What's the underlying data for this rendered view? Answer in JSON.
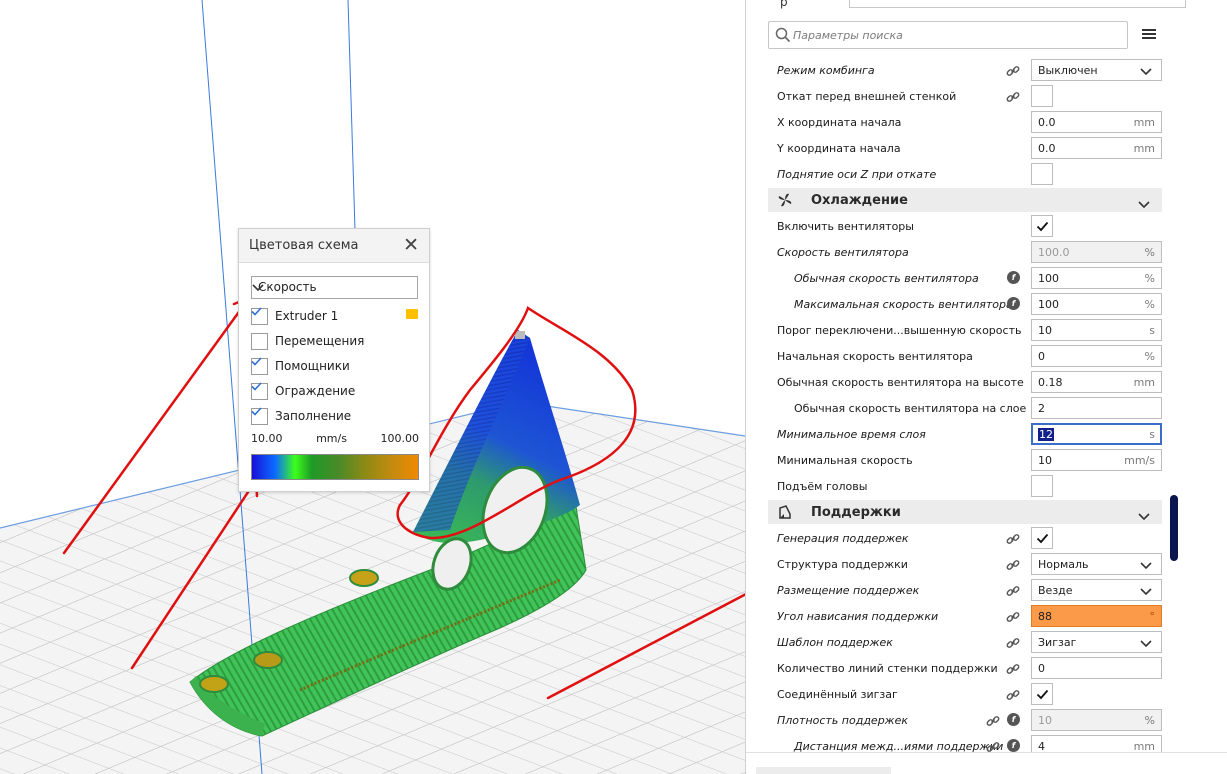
{
  "color_scheme": {
    "title": "Цветовая схема",
    "selected_scheme": "Скорость",
    "options": [
      {
        "label": "Extruder 1",
        "checked": true
      },
      {
        "label": "Перемещения",
        "checked": false
      },
      {
        "label": "Помощники",
        "checked": true
      },
      {
        "label": "Ограждение",
        "checked": true
      },
      {
        "label": "Заполнение",
        "checked": true
      }
    ],
    "legend_min": "10.00",
    "legend_unit": "mm/s",
    "legend_max": "100.00",
    "extruder_color": "#ffc000"
  },
  "settings": {
    "profile_label": "р",
    "search_placeholder": "Параметры поиска",
    "rows": [
      {
        "label": "Режим комбинга",
        "italic": true,
        "link": true,
        "type": "select",
        "value": "Выключен"
      },
      {
        "label": "Откат перед внешней стенкой",
        "italic": false,
        "link": true,
        "type": "checkbox",
        "checked": false
      },
      {
        "label": "X координата начала",
        "italic": false,
        "type": "input",
        "value": "0.0",
        "unit": "mm"
      },
      {
        "label": "Y координата начала",
        "italic": false,
        "type": "input",
        "value": "0.0",
        "unit": "mm"
      },
      {
        "label": "Поднятие оси Z при откате",
        "italic": true,
        "type": "checkbox",
        "checked": false
      },
      {
        "category": "Охлаждение",
        "icon": "fan-icon"
      },
      {
        "label": "Включить вентиляторы",
        "italic": false,
        "type": "checkbox",
        "checked": true
      },
      {
        "label": "Скорость вентилятора",
        "italic": true,
        "type": "input",
        "value": "100.0",
        "unit": "%",
        "disabled": true
      },
      {
        "label": "Обычная скорость вентилятора",
        "italic": true,
        "indent": 1,
        "fx": true,
        "type": "input",
        "value": "100",
        "unit": "%"
      },
      {
        "label": "Максимальная скорость вентилятора",
        "italic": true,
        "indent": 1,
        "fx": true,
        "type": "input",
        "value": "100",
        "unit": "%"
      },
      {
        "label": "Порог переключени...вышенную скорость",
        "italic": false,
        "type": "input",
        "value": "10",
        "unit": "s"
      },
      {
        "label": "Начальная скорость вентилятора",
        "italic": false,
        "type": "input",
        "value": "0",
        "unit": "%"
      },
      {
        "label": "Обычная скорость вентилятора на высоте",
        "italic": false,
        "type": "input",
        "value": "0.18",
        "unit": "mm"
      },
      {
        "label": "Обычная скорость вентилятора на слое",
        "italic": false,
        "indent": 1,
        "type": "input",
        "value": "2",
        "unit": ""
      },
      {
        "label": "Минимальное время слоя",
        "italic": true,
        "type": "input",
        "value": "12",
        "unit": "s",
        "focused": true
      },
      {
        "label": "Минимальная скорость",
        "italic": false,
        "type": "input",
        "value": "10",
        "unit": "mm/s"
      },
      {
        "label": "Подъём головы",
        "italic": false,
        "type": "checkbox",
        "checked": false
      },
      {
        "category": "Поддержки",
        "icon": "support-icon"
      },
      {
        "label": "Генерация поддержек",
        "italic": true,
        "link": true,
        "type": "checkbox",
        "checked": true
      },
      {
        "label": "Структура поддержки",
        "italic": false,
        "link": true,
        "type": "select",
        "value": "Нормаль"
      },
      {
        "label": "Размещение поддержек",
        "italic": true,
        "link": true,
        "type": "select",
        "value": "Везде"
      },
      {
        "label": "Угол нависания поддержки",
        "italic": true,
        "link": true,
        "type": "input",
        "value": "88",
        "unit": "°",
        "warning": true
      },
      {
        "label": "Шаблон поддержек",
        "italic": true,
        "link": true,
        "type": "select",
        "value": "Зигзаг"
      },
      {
        "label": "Количество линий стенки поддержки",
        "italic": false,
        "link": true,
        "type": "input",
        "value": "0",
        "unit": ""
      },
      {
        "label": "Соединённый зигзаг",
        "italic": false,
        "link": true,
        "type": "checkbox",
        "checked": true
      },
      {
        "label": "Плотность поддержек",
        "italic": true,
        "link": true,
        "fx": true,
        "type": "input",
        "value": "10",
        "unit": "%",
        "disabled": true
      },
      {
        "label": "Дистанция межд...иями поддержки",
        "italic": true,
        "indent": 1,
        "link": true,
        "fx": true,
        "type": "input",
        "value": "4",
        "unit": "mm"
      }
    ]
  },
  "colors": {
    "accent_blue": "#11208c",
    "warning_orange": "#fb9a48",
    "annotation_red": "#e01010",
    "model_green": "#3ec25a"
  }
}
